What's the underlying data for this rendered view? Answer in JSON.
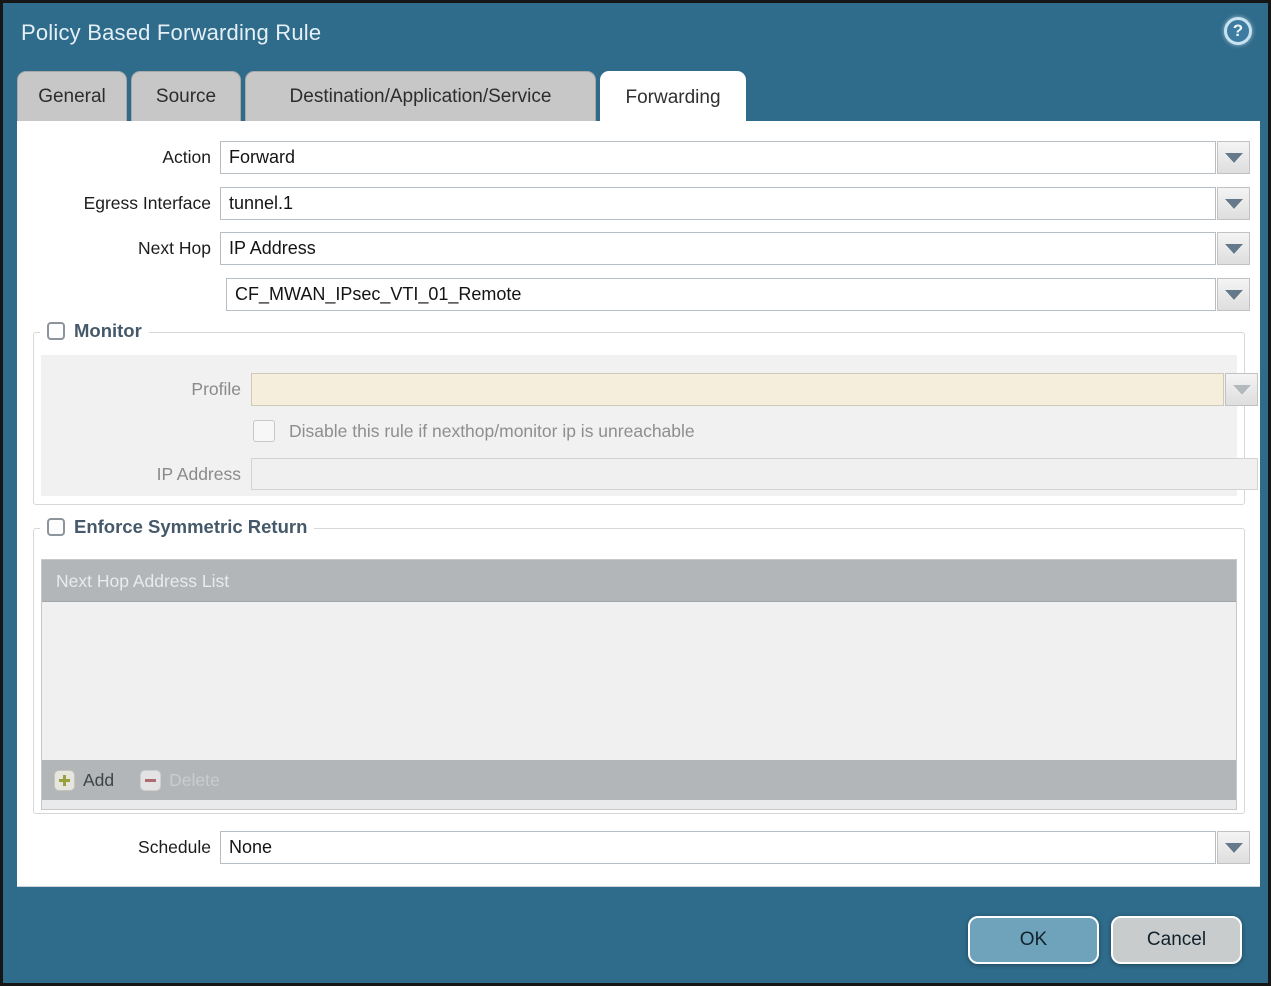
{
  "window": {
    "title": "Policy Based Forwarding Rule",
    "help_glyph": "?"
  },
  "tabs": [
    {
      "label": "General",
      "active": false
    },
    {
      "label": "Source",
      "active": false
    },
    {
      "label": "Destination/Application/Service",
      "active": false
    },
    {
      "label": "Forwarding",
      "active": true
    }
  ],
  "form": {
    "action": {
      "label": "Action",
      "value": "Forward"
    },
    "egress_interface": {
      "label": "Egress Interface",
      "value": "tunnel.1"
    },
    "next_hop": {
      "label": "Next Hop",
      "value": "IP Address"
    },
    "next_hop_address": {
      "value": "CF_MWAN_IPsec_VTI_01_Remote"
    },
    "schedule": {
      "label": "Schedule",
      "value": "None"
    }
  },
  "monitor": {
    "legend": "Monitor",
    "checked": false,
    "profile": {
      "label": "Profile",
      "value": ""
    },
    "disable_rule": {
      "label": "Disable this rule if nexthop/monitor ip is unreachable",
      "checked": false
    },
    "ip_address": {
      "label": "IP Address",
      "value": ""
    }
  },
  "enforce_symmetric_return": {
    "legend": "Enforce Symmetric Return",
    "checked": false,
    "table": {
      "header": "Next Hop Address List",
      "rows": []
    },
    "toolbar": {
      "add_label": "Add",
      "delete_label": "Delete",
      "delete_enabled": false
    }
  },
  "footer": {
    "ok_label": "OK",
    "cancel_label": "Cancel"
  },
  "colors": {
    "titlebar": "#2f6b8a",
    "active_tab": "#ffffff",
    "inactive_tab": "#c7c7c7",
    "disabled_field": "#f5eedc",
    "table_header": "#b2b6b9",
    "ok_button": "#6fa3bc",
    "cancel_button": "#c9cccd",
    "legend_text": "#45596a",
    "add_icon_green": "#97a23c",
    "delete_icon_red": "#b06a72"
  }
}
